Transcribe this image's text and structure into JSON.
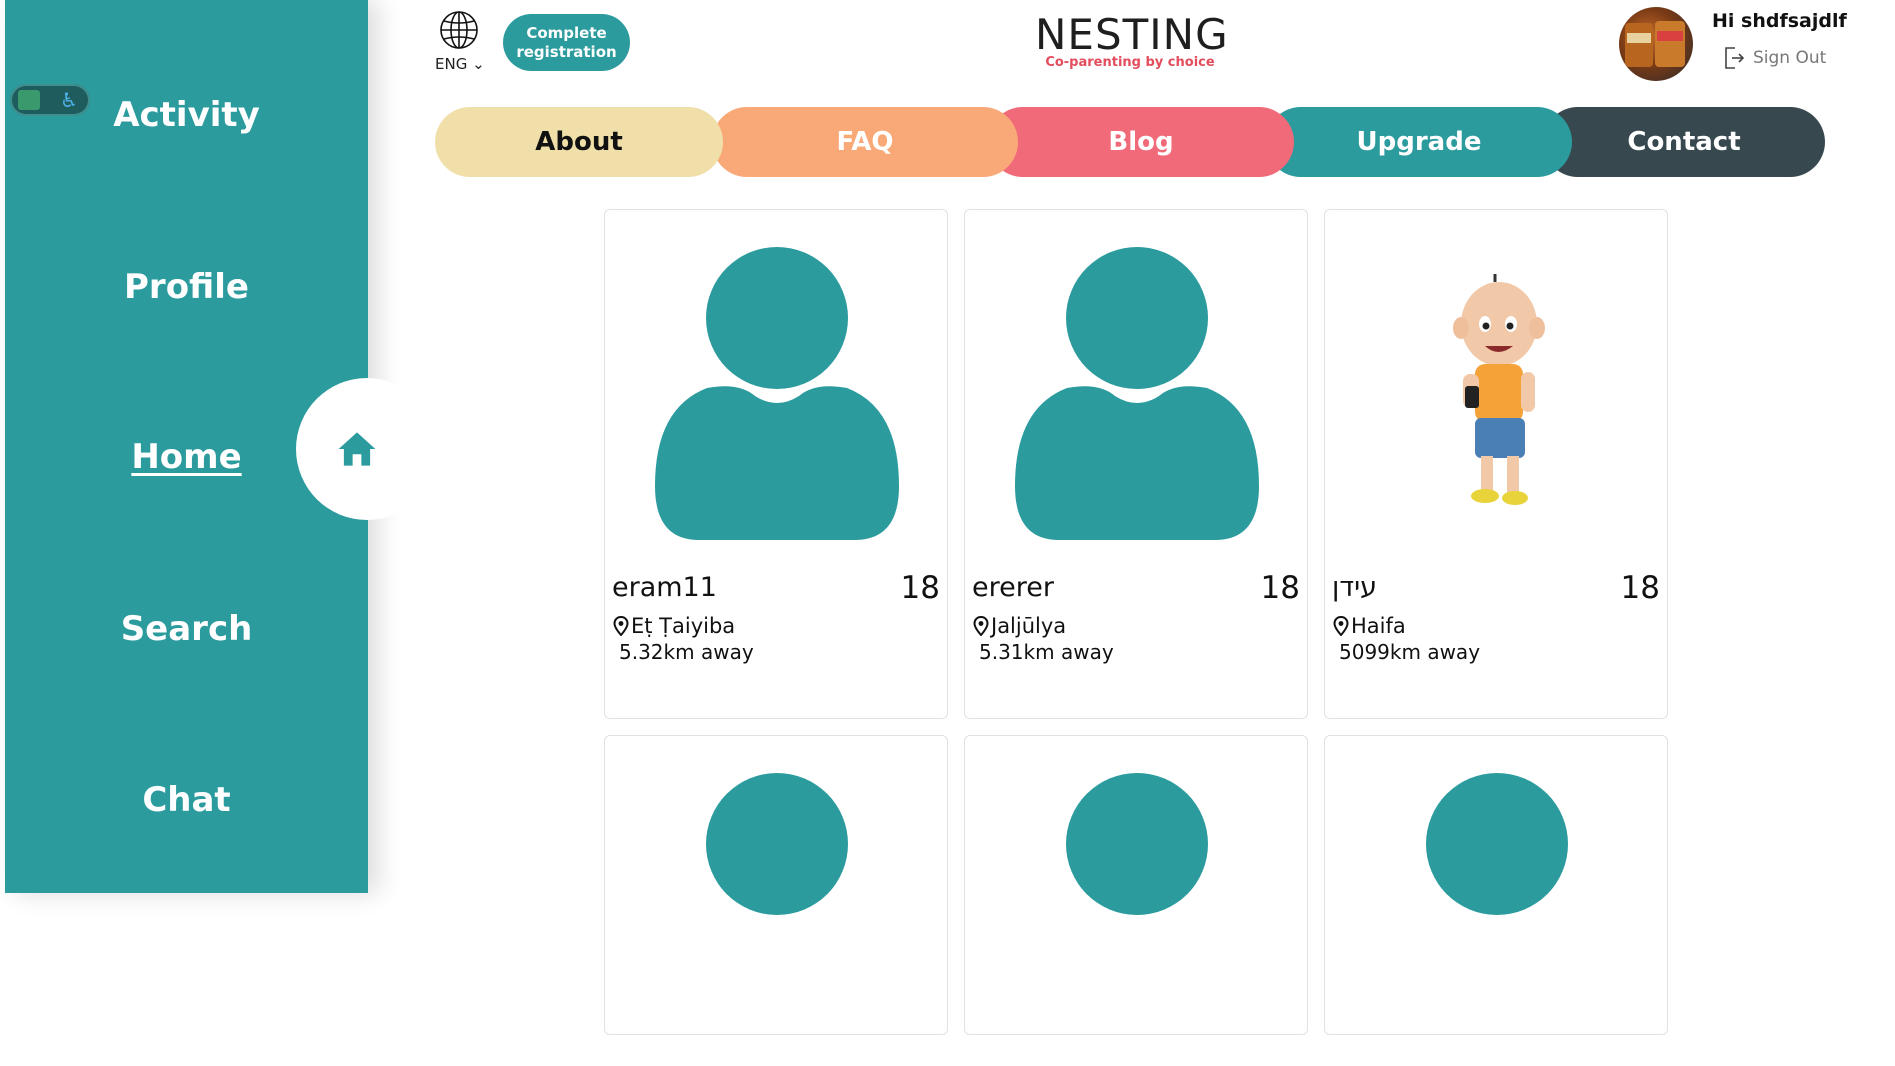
{
  "sidebar": {
    "items": [
      {
        "label": "Activity"
      },
      {
        "label": "Profile"
      },
      {
        "label": "Home"
      },
      {
        "label": "Search"
      },
      {
        "label": "Chat"
      }
    ],
    "active_icon": "home-icon",
    "accessibility_toggle_icon": "accessibility-icon"
  },
  "header": {
    "language": "ENG",
    "complete_registration": "Complete registration",
    "logo": {
      "title": "NESTING",
      "tagline": "Co-parenting by choice"
    },
    "greeting": "Hi shdfsajdlf",
    "sign_out": "Sign Out"
  },
  "menu": {
    "items": [
      {
        "label": "About",
        "color": "#f0dfa9",
        "text_color": "#111111"
      },
      {
        "label": "FAQ",
        "color": "#f9a978",
        "text_color": "#ffffff"
      },
      {
        "label": "Blog",
        "color": "#f16a79",
        "text_color": "#ffffff"
      },
      {
        "label": "Upgrade",
        "color": "#2b9b9e",
        "text_color": "#ffffff"
      },
      {
        "label": "Contact",
        "color": "#37494f",
        "text_color": "#ffffff"
      }
    ]
  },
  "profiles": [
    {
      "name": "eram11",
      "age": "18",
      "location": "Eṭ Ṭaiyiba",
      "distance": "5.32km away",
      "photo": "default-avatar"
    },
    {
      "name": "ererer",
      "age": "18",
      "location": "Jaljūlya",
      "distance": "5.31km away",
      "photo": "default-avatar"
    },
    {
      "name": "עידן",
      "age": "18",
      "location": "Haifa",
      "distance": "5099km away",
      "photo": "cartoon-boy"
    }
  ],
  "colors": {
    "accent": "#2b9b9e",
    "logo_tagline": "#e34d5d"
  }
}
